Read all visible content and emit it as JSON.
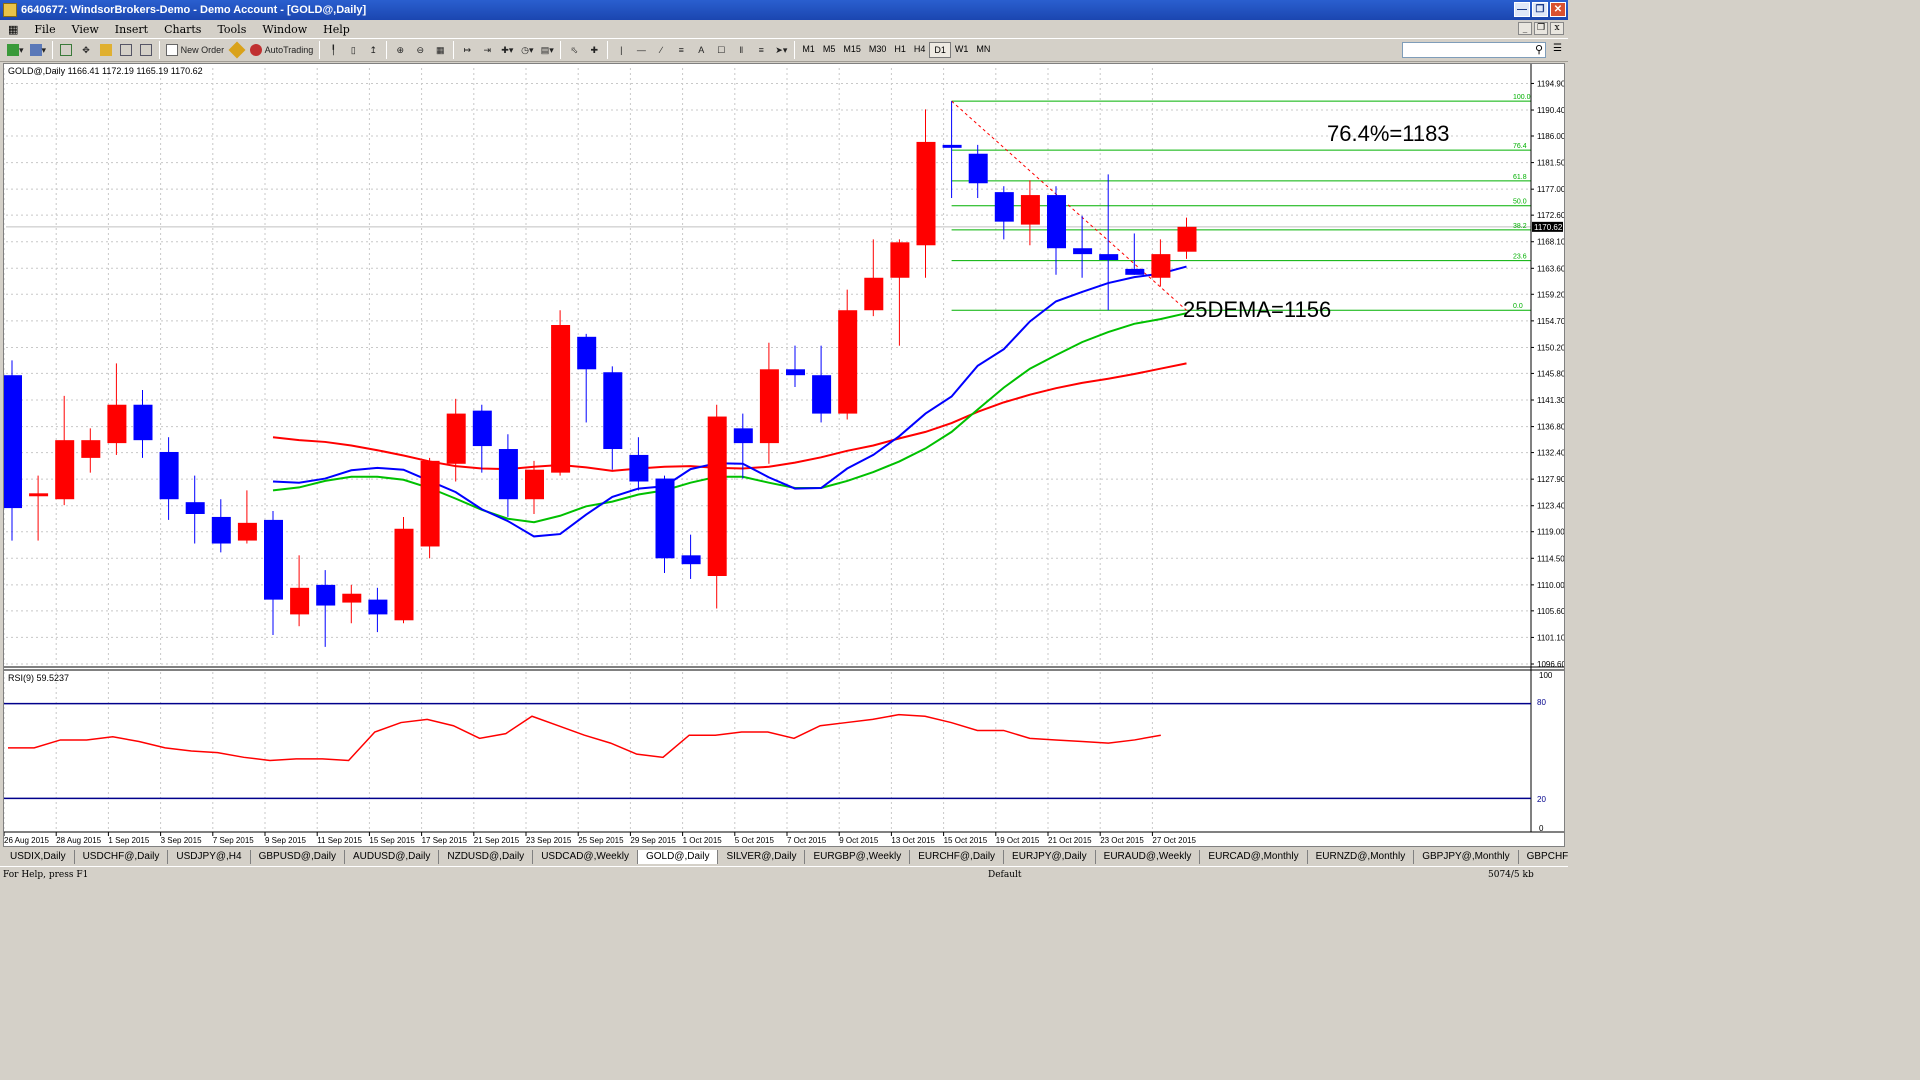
{
  "window": {
    "title": "6640677: WindsorBrokers-Demo - Demo Account - [GOLD@,Daily]"
  },
  "menu": [
    "File",
    "View",
    "Insert",
    "Charts",
    "Tools",
    "Window",
    "Help"
  ],
  "toolbar": {
    "new_order": "New Order",
    "auto_trading": "AutoTrading",
    "timeframes": [
      "M1",
      "M5",
      "M15",
      "M30",
      "H1",
      "H4",
      "D1",
      "W1",
      "MN"
    ],
    "active_timeframe": "D1"
  },
  "chart": {
    "header": "GOLD@,Daily  1166.41 1172.19 1165.19 1170.62",
    "current_price": "1170.62",
    "annotation_fib": "76.4%=1183",
    "annotation_ema": "25DEMA=1156",
    "price_ticks": [
      "1194.90",
      "1190.40",
      "1186.00",
      "1181.50",
      "1177.00",
      "1172.60",
      "1168.10",
      "1163.60",
      "1159.20",
      "1154.70",
      "1150.20",
      "1145.80",
      "1141.30",
      "1136.80",
      "1132.40",
      "1127.90",
      "1123.40",
      "1119.00",
      "1114.50",
      "1110.00",
      "1105.60",
      "1101.10",
      "1096.60"
    ],
    "fib_levels": [
      {
        "label": "100.0",
        "price": 1191.9
      },
      {
        "label": "76.4",
        "price": 1183.6
      },
      {
        "label": "61.8",
        "price": 1178.4
      },
      {
        "label": "50.0",
        "price": 1174.2
      },
      {
        "label": "38.2",
        "price": 1170.1
      },
      {
        "label": "23.6",
        "price": 1164.9
      },
      {
        "label": "0.0",
        "price": 1156.5
      }
    ],
    "date_labels": [
      "26 Aug 2015",
      "28 Aug 2015",
      "1 Sep 2015",
      "3 Sep 2015",
      "7 Sep 2015",
      "9 Sep 2015",
      "11 Sep 2015",
      "15 Sep 2015",
      "17 Sep 2015",
      "21 Sep 2015",
      "23 Sep 2015",
      "25 Sep 2015",
      "29 Sep 2015",
      "1 Oct 2015",
      "5 Oct 2015",
      "7 Oct 2015",
      "9 Oct 2015",
      "13 Oct 2015",
      "15 Oct 2015",
      "19 Oct 2015",
      "21 Oct 2015",
      "23 Oct 2015",
      "27 Oct 2015"
    ],
    "colors": {
      "bull": "#0000ff",
      "bear": "#ff0000",
      "ema_fast": "#0000ff",
      "ema_mid": "#00c000",
      "ema_slow": "#ff0000",
      "fib": "#00b000",
      "rsi": "#ff0000",
      "rsi_levels": "#00008b"
    }
  },
  "rsi": {
    "label": "RSI(9) 59.5237",
    "tick_top": "100",
    "tick_bottom": "0",
    "level_high": "80",
    "level_low": "20"
  },
  "chart_data": {
    "type": "candlestick",
    "symbol": "GOLD@",
    "timeframe": "Daily",
    "ylim": [
      1096.6,
      1196.5
    ],
    "candles": [
      {
        "o": 1145.5,
        "h": 1148.0,
        "l": 1117.5,
        "c": 1123.0
      },
      {
        "o": 1125.0,
        "h": 1128.5,
        "l": 1117.5,
        "c": 1125.5
      },
      {
        "o": 1124.5,
        "h": 1142.0,
        "l": 1123.5,
        "c": 1134.5
      },
      {
        "o": 1131.5,
        "h": 1136.5,
        "l": 1129.0,
        "c": 1134.5
      },
      {
        "o": 1134.0,
        "h": 1147.5,
        "l": 1132.0,
        "c": 1140.5
      },
      {
        "o": 1140.5,
        "h": 1143.0,
        "l": 1131.5,
        "c": 1134.5
      },
      {
        "o": 1132.5,
        "h": 1135.0,
        "l": 1121.0,
        "c": 1124.5
      },
      {
        "o": 1124.0,
        "h": 1128.5,
        "l": 1117.0,
        "c": 1122.0
      },
      {
        "o": 1121.5,
        "h": 1124.5,
        "l": 1115.5,
        "c": 1117.0
      },
      {
        "o": 1117.5,
        "h": 1126.0,
        "l": 1117.0,
        "c": 1120.5
      },
      {
        "o": 1121.0,
        "h": 1122.5,
        "l": 1101.5,
        "c": 1107.5
      },
      {
        "o": 1105.0,
        "h": 1115.0,
        "l": 1103.0,
        "c": 1109.5
      },
      {
        "o": 1110.0,
        "h": 1112.5,
        "l": 1099.5,
        "c": 1106.5
      },
      {
        "o": 1107.0,
        "h": 1110.0,
        "l": 1103.5,
        "c": 1108.5
      },
      {
        "o": 1107.5,
        "h": 1109.5,
        "l": 1102.0,
        "c": 1105.0
      },
      {
        "o": 1104.0,
        "h": 1121.5,
        "l": 1103.5,
        "c": 1119.5
      },
      {
        "o": 1116.5,
        "h": 1131.5,
        "l": 1114.5,
        "c": 1131.0
      },
      {
        "o": 1130.5,
        "h": 1141.5,
        "l": 1127.5,
        "c": 1139.0
      },
      {
        "o": 1139.5,
        "h": 1140.5,
        "l": 1129.0,
        "c": 1133.5
      },
      {
        "o": 1133.0,
        "h": 1135.5,
        "l": 1121.5,
        "c": 1124.5
      },
      {
        "o": 1124.5,
        "h": 1131.0,
        "l": 1122.0,
        "c": 1129.5
      },
      {
        "o": 1129.0,
        "h": 1156.5,
        "l": 1128.5,
        "c": 1154.0
      },
      {
        "o": 1152.0,
        "h": 1152.5,
        "l": 1137.5,
        "c": 1146.5
      },
      {
        "o": 1146.0,
        "h": 1147.0,
        "l": 1129.5,
        "c": 1133.0
      },
      {
        "o": 1132.0,
        "h": 1135.0,
        "l": 1126.0,
        "c": 1127.5
      },
      {
        "o": 1128.0,
        "h": 1128.5,
        "l": 1112.0,
        "c": 1114.5
      },
      {
        "o": 1115.0,
        "h": 1118.5,
        "l": 1111.0,
        "c": 1113.5
      },
      {
        "o": 1111.5,
        "h": 1140.5,
        "l": 1106.0,
        "c": 1138.5
      },
      {
        "o": 1136.5,
        "h": 1139.0,
        "l": 1128.0,
        "c": 1134.0
      },
      {
        "o": 1134.0,
        "h": 1151.0,
        "l": 1130.5,
        "c": 1146.5
      },
      {
        "o": 1146.5,
        "h": 1150.5,
        "l": 1143.5,
        "c": 1145.5
      },
      {
        "o": 1145.5,
        "h": 1150.5,
        "l": 1137.5,
        "c": 1139.0
      },
      {
        "o": 1139.0,
        "h": 1160.0,
        "l": 1138.0,
        "c": 1156.5
      },
      {
        "o": 1156.5,
        "h": 1168.5,
        "l": 1155.5,
        "c": 1162.0
      },
      {
        "o": 1162.0,
        "h": 1168.5,
        "l": 1150.5,
        "c": 1168.0
      },
      {
        "o": 1167.5,
        "h": 1190.5,
        "l": 1162.0,
        "c": 1185.0
      },
      {
        "o": 1184.5,
        "h": 1191.9,
        "l": 1175.5,
        "c": 1184.0
      },
      {
        "o": 1183.0,
        "h": 1184.5,
        "l": 1175.5,
        "c": 1178.0
      },
      {
        "o": 1176.5,
        "h": 1177.5,
        "l": 1168.5,
        "c": 1171.5
      },
      {
        "o": 1171.0,
        "h": 1178.5,
        "l": 1167.5,
        "c": 1176.0
      },
      {
        "o": 1176.0,
        "h": 1177.5,
        "l": 1162.5,
        "c": 1167.0
      },
      {
        "o": 1167.0,
        "h": 1172.5,
        "l": 1162.0,
        "c": 1166.0
      },
      {
        "o": 1166.0,
        "h": 1179.5,
        "l": 1156.5,
        "c": 1165.0
      },
      {
        "o": 1163.5,
        "h": 1169.5,
        "l": 1162.5,
        "c": 1162.5
      },
      {
        "o": 1162.0,
        "h": 1168.5,
        "l": 1160.5,
        "c": 1166.0
      },
      {
        "o": 1166.41,
        "h": 1172.19,
        "l": 1165.19,
        "c": 1170.62
      }
    ],
    "ema_fast": [
      1127.5,
      1127.3,
      1128.0,
      1129.4,
      1129.8,
      1129.5,
      1127.6,
      1125.7,
      1122.8,
      1120.8,
      1118.2,
      1118.6,
      1121.9,
      1124.9,
      1126.3,
      1126.7,
      1129.6,
      1130.6,
      1130.5,
      1128.2,
      1126.3,
      1126.4,
      1129.7,
      1132.0,
      1135.2,
      1139.0,
      1141.9,
      1147.1,
      1149.9,
      1154.6,
      1158.0,
      1159.6,
      1161.1,
      1162.1,
      1162.7,
      1163.9
    ],
    "ema_mid": [
      1126.0,
      1126.5,
      1127.6,
      1128.3,
      1128.3,
      1127.8,
      1126.4,
      1124.6,
      1122.7,
      1121.2,
      1120.6,
      1121.7,
      1123.3,
      1124.1,
      1125.3,
      1126.0,
      1127.3,
      1128.3,
      1128.3,
      1127.3,
      1126.4,
      1126.4,
      1127.6,
      1129.1,
      1130.9,
      1133.1,
      1135.9,
      1139.7,
      1143.4,
      1146.6,
      1148.9,
      1151.1,
      1152.8,
      1154.2,
      1155.0,
      1156.0
    ],
    "ema_slow": [
      1135.0,
      1134.5,
      1134.2,
      1133.6,
      1132.8,
      1131.9,
      1130.9,
      1130.1,
      1129.7,
      1129.6,
      1130.0,
      1130.3,
      1129.9,
      1129.3,
      1129.7,
      1130.0,
      1130.1,
      1129.8,
      1129.7,
      1130.0,
      1130.7,
      1131.6,
      1132.7,
      1133.6,
      1134.8,
      1135.9,
      1137.4,
      1139.3,
      1140.9,
      1142.2,
      1143.3,
      1144.2,
      1144.9,
      1145.7,
      1146.6,
      1147.5
    ],
    "rsi": [
      52,
      52,
      57,
      57,
      59,
      56,
      52,
      50,
      49,
      46,
      44,
      45,
      45,
      44,
      62,
      68,
      70,
      66,
      58,
      61,
      72,
      66,
      60,
      55,
      48,
      46,
      60,
      60,
      62,
      62,
      58,
      66,
      68,
      70,
      73,
      72,
      68,
      63,
      63,
      58,
      57,
      56,
      55,
      57,
      60
    ]
  }
}
